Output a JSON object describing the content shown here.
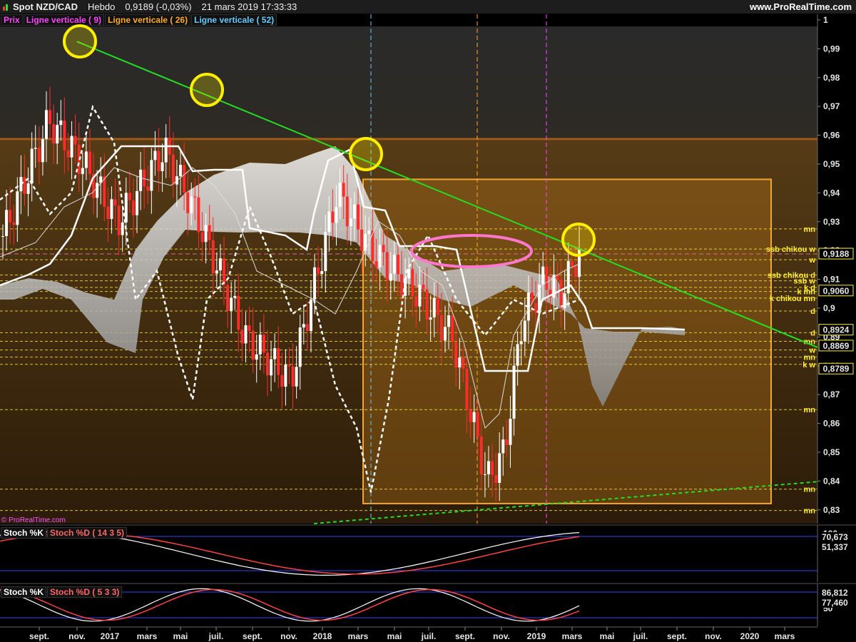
{
  "header": {
    "instrument": "Spot NZD/CAD",
    "period": "Hebdo",
    "last": "0,9189 (-0,03%)",
    "datetime": "21 mars 2019 17:33:33",
    "brand": "www.ProRealTime.com"
  },
  "legend": [
    {
      "label": "Prix",
      "color": "#ff44ff"
    },
    {
      "label": "Ligne verticale ( 9)",
      "color": "#ff44ff"
    },
    {
      "label": "Ligne verticale ( 26)",
      "color": "#ffaa22"
    },
    {
      "label": "Ligne verticale ( 52)",
      "color": "#66ccff"
    }
  ],
  "watermark": "© ProRealTime.com",
  "colors": {
    "background": "#000000",
    "up_candle": "#ffffff",
    "down_candle": "#ff2a2a",
    "trendline": "#22dd22",
    "level_line": "#ffee33",
    "resistance_zone": "#c07a1a",
    "kumo": "#d8d8d8",
    "circle_marker": "#ffee00",
    "ellipse_marker": "#ff77cc"
  },
  "chart_data": [
    {
      "type": "candlestick",
      "title": "Spot NZD/CAD",
      "timeframe": "Hebdo",
      "ylim": [
        0.825,
        1.0
      ],
      "y_ticks": [
        "1",
        "0,99",
        "0,98",
        "0,97",
        "0,96",
        "0,95",
        "0,94",
        "0,93",
        "0,92",
        "0,91",
        "0,9",
        "0,89",
        "0,88",
        "0,87",
        "0,86",
        "0,85",
        "0,84",
        "0,83"
      ],
      "x_ticks": [
        "sept.",
        "nov.",
        "2017",
        "mars",
        "mai",
        "juil.",
        "sept.",
        "nov.",
        "2018",
        "mars",
        "mai",
        "juil.",
        "sept.",
        "nov.",
        "2019",
        "mars",
        "mai",
        "juil.",
        "sept.",
        "nov.",
        "2020",
        "mars"
      ],
      "price_labels": [
        {
          "text": "0,9188",
          "value": 0.9188,
          "style": "current"
        },
        {
          "text": "0,9188",
          "value": 0.9188
        },
        {
          "text": "0,9060",
          "value": 0.906
        },
        {
          "text": "0,8924",
          "value": 0.8924
        },
        {
          "text": "0,8869",
          "value": 0.8869
        },
        {
          "text": "0,8789",
          "value": 0.8789
        }
      ],
      "level_labels": [
        {
          "text": "mn",
          "value": 0.9275
        },
        {
          "text": "ssb chikou w",
          "value": 0.9205
        },
        {
          "text": "w",
          "value": 0.9168
        },
        {
          "text": "ssb chikou d",
          "value": 0.9115
        },
        {
          "text": "ssb w",
          "value": 0.9095
        },
        {
          "text": "k d",
          "value": 0.9072
        },
        {
          "text": "k mn",
          "value": 0.9058
        },
        {
          "text": "k chikou mn",
          "value": 0.9035
        },
        {
          "text": "d",
          "value": 0.899
        },
        {
          "text": "d",
          "value": 0.8915
        },
        {
          "text": "mn",
          "value": 0.8885
        },
        {
          "text": "w",
          "value": 0.8855
        },
        {
          "text": "mn",
          "value": 0.883
        },
        {
          "text": "k w",
          "value": 0.8805
        },
        {
          "text": "mn",
          "value": 0.8648
        },
        {
          "text": "mn",
          "value": 0.8372
        },
        {
          "text": "mn",
          "value": 0.8298
        }
      ],
      "zones": [
        {
          "from": 0.9587,
          "to": 0.831,
          "note": "upper band"
        },
        {
          "from": 0.9447,
          "to": 0.8322,
          "note": "rectangle"
        }
      ],
      "candles": []
    },
    {
      "type": "line",
      "title": "Stoch %K / Stoch %D ( 14 3 5)",
      "labels": [
        "Stoch %K",
        "Stoch %D ( 14 3 5)"
      ],
      "ylim": [
        0,
        100
      ],
      "y_ticks": [
        "100"
      ],
      "last_values": [
        "70,673",
        "51,337"
      ]
    },
    {
      "type": "line",
      "title": "Stoch %K / Stoch %D ( 5 3 3)",
      "labels": [
        "Stoch %K",
        "Stoch %D ( 5 3 3)"
      ],
      "ylim": [
        0,
        100
      ],
      "y_ticks": [
        "50"
      ],
      "last_values": [
        "86,812",
        "77,460"
      ]
    }
  ]
}
